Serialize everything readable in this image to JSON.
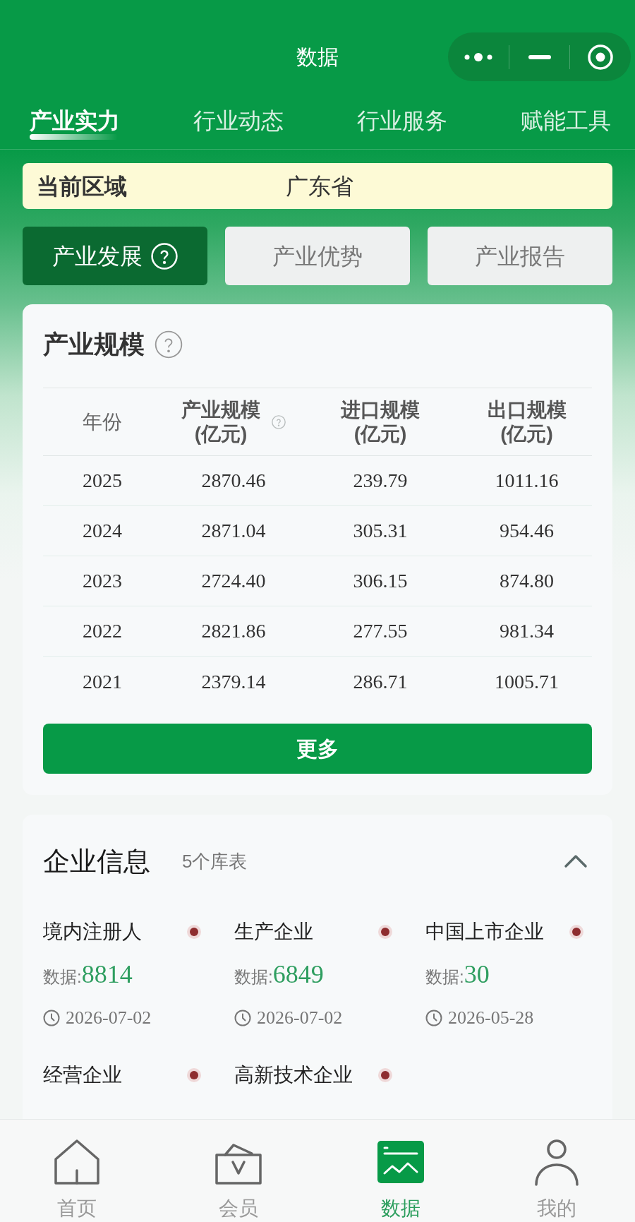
{
  "window": {
    "title": "数据"
  },
  "tabs": [
    {
      "label": "产业实力",
      "selected": true
    },
    {
      "label": "行业动态",
      "selected": false
    },
    {
      "label": "行业服务",
      "selected": false
    },
    {
      "label": "赋能工具",
      "selected": false
    }
  ],
  "region": {
    "label": "当前区域",
    "value": "广东省"
  },
  "section_tabs": [
    {
      "label": "产业发展",
      "selected": true,
      "help": true
    },
    {
      "label": "产业优势",
      "selected": false,
      "help": false
    },
    {
      "label": "产业报告",
      "selected": false,
      "help": false
    }
  ],
  "scale_card": {
    "title": "产业规模",
    "help": true,
    "table": {
      "columns": [
        {
          "title": "年份",
          "help": false
        },
        {
          "title": "产业规模",
          "unit": "(亿元)",
          "help": true
        },
        {
          "title": "进口规模",
          "unit": "(亿元)",
          "help": false
        },
        {
          "title": "出口规模",
          "unit": "(亿元)",
          "help": false
        }
      ],
      "rows": [
        [
          "2025",
          "2870.46",
          "239.79",
          "1011.16"
        ],
        [
          "2024",
          "2871.04",
          "305.31",
          "954.46"
        ],
        [
          "2023",
          "2724.40",
          "306.15",
          "874.80"
        ],
        [
          "2022",
          "2821.86",
          "277.55",
          "981.34"
        ],
        [
          "2021",
          "2379.14",
          "286.71",
          "1005.71"
        ]
      ]
    },
    "more_button": "更多"
  },
  "enterprise": {
    "title": "企业信息",
    "count": "5个库表",
    "expanded": true,
    "items": [
      {
        "name": "境内注册人",
        "new": true,
        "data_label": "数据:",
        "value": "8814",
        "date": "2026-07-02"
      },
      {
        "name": "生产企业",
        "new": true,
        "data_label": "数据:",
        "value": "6849",
        "date": "2026-07-02"
      },
      {
        "name": "中国上市企业",
        "new": true,
        "data_label": "数据:",
        "value": "30",
        "date": "2026-05-28"
      },
      {
        "name": "经营企业",
        "new": true
      },
      {
        "name": "高新技术企业",
        "new": true
      }
    ]
  },
  "bottom_nav": [
    {
      "label": "首页",
      "kind": "home",
      "selected": false
    },
    {
      "label": "会员",
      "kind": "member",
      "selected": false
    },
    {
      "label": "数据",
      "kind": "data",
      "selected": true
    },
    {
      "label": "我的",
      "kind": "profile",
      "selected": false
    }
  ]
}
